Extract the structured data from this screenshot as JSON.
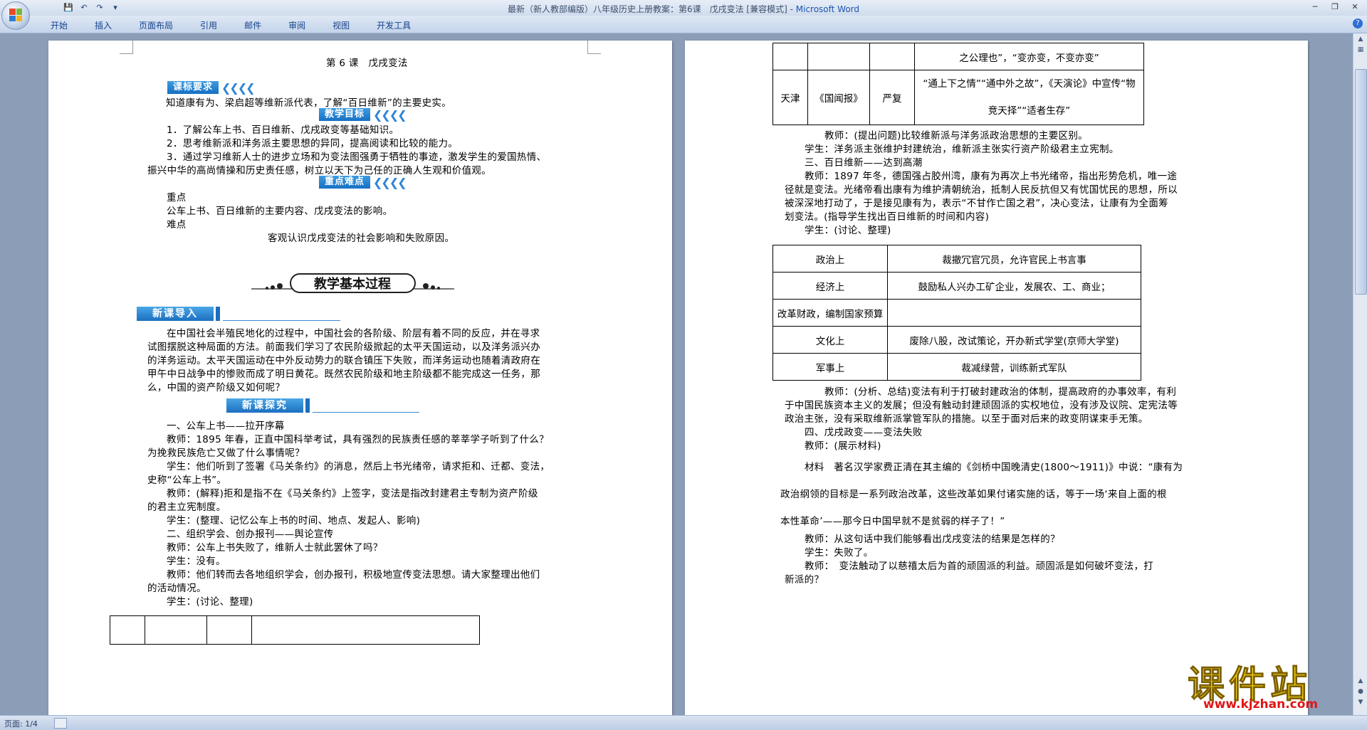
{
  "window": {
    "title": "最新（新人教部编版）八年级历史上册教案：第6课　戊戌变法 [兼容模式] - ",
    "app_name": "Microsoft Word"
  },
  "ribbon": {
    "tabs": [
      "开始",
      "插入",
      "页面布局",
      "引用",
      "邮件",
      "审阅",
      "视图",
      "开发工具"
    ]
  },
  "page1": {
    "title": "第 6 课　戊戌变法",
    "banner_requirements": "课标要求",
    "requirements_text": "知道康有为、梁启超等维新派代表，了解“百日维新”的主要史实。",
    "banner_goals": "教学目标",
    "goals": [
      "1．了解公车上书、百日维新、戊戌政变等基础知识。",
      "2．思考维新派和洋务派主要思想的异同，提高阅读和比较的能力。",
      "3．通过学习维新人士的进步立场和为变法图强勇于牺牲的事迹，激发学生的爱国热情、",
      "振兴中华的高尚情操和历史责任感，树立以天下为己任的正确人生观和价值观。"
    ],
    "banner_keypoints": "重点难点",
    "key_label": "重点",
    "key_text": "公车上书、百日维新的主要内容、戊戌变法的影响。",
    "difficult_label": "难点",
    "difficult_text": "客观认识戊戌变法的社会影响和失败原因。",
    "process_title": "教学基本过程",
    "section_intro": "新课导入",
    "intro_lines": [
      "在中国社会半殖民地化的过程中，中国社会的各阶级、阶层有着不同的反应，并在寻求",
      "试图摆脱这种局面的方法。前面我们学习了农民阶级掀起的太平天国运动，以及洋务派兴办",
      "的洋务运动。太平天国运动在中外反动势力的联合镇压下失败，而洋务运动也随着清政府在",
      "甲午中日战争中的惨败而成了明日黄花。既然农民阶级和地主阶级都不能完成这一任务，那",
      "么，中国的资产阶级又如何呢？"
    ],
    "section_explore": "新课探究",
    "explore_lines": [
      "一、公车上书——拉开序幕",
      "教师：1895 年春，正直中国科举考试，具有强烈的民族责任感的莘莘学子听到了什么？",
      "为挽救民族危亡又做了什么事情呢？",
      "学生：他们听到了签署《马关条约》的消息，然后上书光绪帝，请求拒和、迁都、变法，",
      "史称“公车上书”。",
      "教师：(解释)拒和是指不在《马关条约》上签字，变法是指改封建君主专制为资产阶级",
      "的君主立宪制度。",
      "学生：(整理、记忆公车上书的时间、地点、发起人、影响)",
      "二、组织学会、创办报刊——舆论宣传",
      "教师：公车上书失败了，维新人士就此罢休了吗？",
      "学生：没有。",
      "教师：他们转而去各地组织学会，创办报刊，积极地宣传变法思想。请大家整理出他们",
      "的活动情况。",
      "学生：(讨论、整理)"
    ]
  },
  "page2": {
    "top_table": {
      "row1": [
        "",
        "",
        "",
        "之公理也”，“变亦变，不变亦变”"
      ],
      "row2": [
        "天津",
        "《国闻报》",
        "严复",
        "“通上下之情”“通中外之故”，《天演论》中宣传“物",
        "竞天择”“适者生存”"
      ]
    },
    "lines_a": [
      "教师：(提出问题)比较维新派与洋务派政治思想的主要区别。",
      "学生：洋务派主张维护封建统治，维新派主张实行资产阶级君主立宪制。",
      "三、百日维新——达到高潮",
      "教师：1897 年冬，德国强占胶州湾，康有为再次上书光绪帝，指出形势危机，唯一途",
      "径就是变法。光绪帝看出康有为维护清朝统治，抵制人民反抗但又有忧国忧民的思想，所以",
      "被深深地打动了，于是接见康有为，表示“不甘作亡国之君”，决心变法，让康有为全面筹",
      "划变法。(指导学生找出百日维新的时间和内容)",
      "学生：(讨论、整理)"
    ],
    "reform_table": [
      [
        "政治上",
        "裁撤冗官冗员，允许官民上书言事"
      ],
      [
        "经济上",
        "鼓励私人兴办工矿企业，发展农、工、商业；"
      ],
      [
        "改革财政，编制国家预算",
        ""
      ],
      [
        "文化上",
        "废除八股，改试策论，开办新式学堂(京师大学堂)"
      ],
      [
        "军事上",
        "裁减绿营，训练新式军队"
      ]
    ],
    "lines_b": [
      "教师：(分析、总结)变法有利于打破封建政治的体制，提高政府的办事效率，有利",
      "于中国民族资本主义的发展；但没有触动封建顽固派的实权地位，没有涉及议院、定宪法等",
      "政治主张，没有采取维新派掌管军队的措施。以至于面对后来的政变阴谋束手无策。",
      "四、戊戌政变——变法失败",
      "教师：(展示材料)"
    ],
    "material_lines": [
      "材料　著名汉学家费正清在其主编的《剑桥中国晚清史(1800～1911)》中说：“康有为",
      "政治纲领的目标是一系列政治改革，这些改革如果付诸实施的话，等于一场‘来自上面的根",
      "本性革命’——那今日中国早就不是贫弱的样子了！”"
    ],
    "lines_c": [
      "教师：从这句话中我们能够看出戊戌变法的结果是怎样的？",
      "学生：失败了。",
      "教师：　变法触动了以慈禧太后为首的顽固派的利益。顽固派是如何破坏变法，打",
      "新派的？"
    ]
  },
  "statusbar": {
    "page_info": "页面: 1/4"
  },
  "watermark": {
    "brand": "课件站",
    "url": "www.kjzhan.com"
  },
  "colors": {
    "accent": "#1670c4",
    "workspace": "#8c9db8"
  }
}
